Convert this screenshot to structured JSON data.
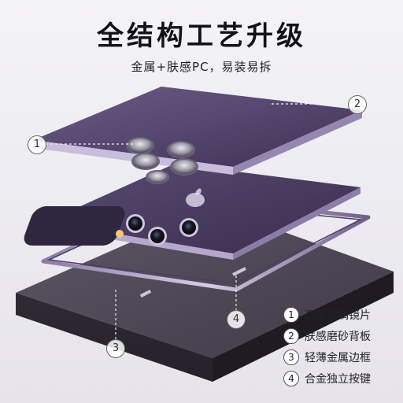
{
  "title": "全结构工艺升级",
  "subtitle": "金属+肤感PC，易装易拆",
  "callouts": [
    "1",
    "2",
    "3",
    "4"
  ],
  "legend": [
    {
      "num": "1",
      "label": "高清玻璃镜片"
    },
    {
      "num": "2",
      "label": "肤感磨砂背板"
    },
    {
      "num": "3",
      "label": "轻薄金属边框"
    },
    {
      "num": "4",
      "label": "合金独立按键"
    }
  ]
}
